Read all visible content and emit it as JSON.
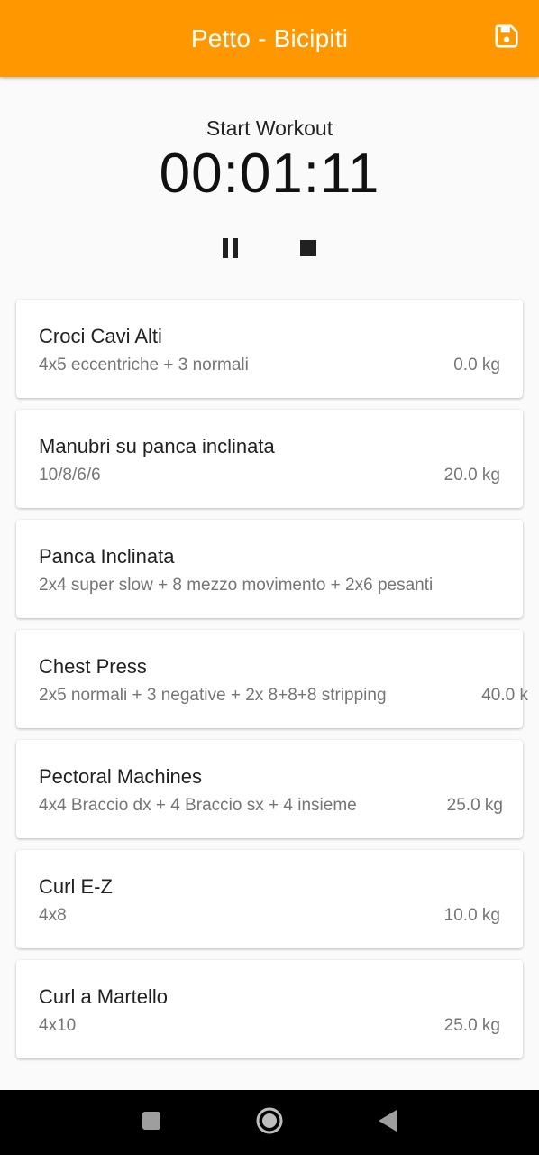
{
  "appbar": {
    "title": "Petto - Bicipiti",
    "save_icon": "save-icon",
    "color": "#ff9800"
  },
  "timer": {
    "label": "Start Workout",
    "value": "00:01:11",
    "pause_icon": "pause-icon",
    "stop_icon": "stop-icon"
  },
  "exercises": [
    {
      "name": "Croci Cavi Alti",
      "scheme": "4x5 eccentriche + 3 normali",
      "weight": "0.0 kg"
    },
    {
      "name": "Manubri su panca inclinata",
      "scheme": "10/8/6/6",
      "weight": "20.0 kg"
    },
    {
      "name": "Panca Inclinata",
      "scheme": "2x4 super slow + 8 mezzo movimento + 2x6 pesanti",
      "weight": ""
    },
    {
      "name": "Chest Press",
      "scheme": "2x5 normali + 3 negative + 2x 8+8+8 stripping",
      "weight": "40.0 k"
    },
    {
      "name": "Pectoral Machines",
      "scheme": "4x4 Braccio dx + 4 Braccio sx + 4 insieme",
      "weight": "25.0 kg"
    },
    {
      "name": "Curl E-Z",
      "scheme": "4x8",
      "weight": "10.0 kg"
    },
    {
      "name": "Curl a Martello",
      "scheme": "4x10",
      "weight": "25.0 kg"
    }
  ],
  "navbar": {
    "recent_icon": "recent-apps-icon",
    "home_icon": "home-icon",
    "back_icon": "back-icon"
  }
}
